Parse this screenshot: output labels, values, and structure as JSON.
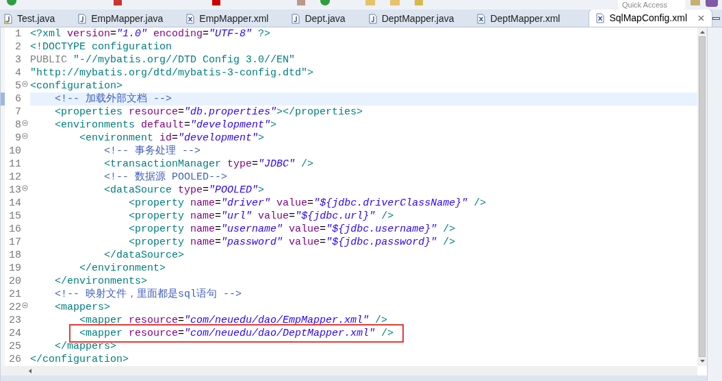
{
  "toolbar": {
    "quick_access": {
      "placeholder": "Quick Access"
    }
  },
  "tabs": [
    {
      "label": "Test.java",
      "kind": "java",
      "warning": true,
      "selected": false
    },
    {
      "label": "EmpMapper.java",
      "kind": "java",
      "warning": false,
      "selected": false
    },
    {
      "label": "EmpMapper.xml",
      "kind": "xml",
      "warning": false,
      "selected": false
    },
    {
      "label": "Dept.java",
      "kind": "java",
      "warning": false,
      "selected": false
    },
    {
      "label": "DeptMapper.java",
      "kind": "java",
      "warning": false,
      "selected": false
    },
    {
      "label": "DeptMapper.xml",
      "kind": "xml",
      "warning": false,
      "selected": false
    },
    {
      "label": "SqlMapConfig.xml",
      "kind": "xml",
      "warning": false,
      "selected": true
    }
  ],
  "editor": {
    "lines": [
      {
        "number": "1",
        "fold": false,
        "current": false,
        "boxed": false,
        "tokens": [
          {
            "kind": "tag",
            "text": "<?xml "
          },
          {
            "kind": "attr",
            "text": "version"
          },
          {
            "kind": "plain",
            "text": "="
          },
          {
            "kind": "value",
            "text": "\"1.0\""
          },
          {
            "kind": "attr",
            "text": " encoding"
          },
          {
            "kind": "plain",
            "text": "="
          },
          {
            "kind": "value",
            "text": "\"UTF-8\""
          },
          {
            "kind": "tag",
            "text": " ?>"
          }
        ]
      },
      {
        "number": "2",
        "fold": false,
        "current": false,
        "boxed": false,
        "tokens": [
          {
            "kind": "tag",
            "text": "<!DOCTYPE configuration"
          }
        ]
      },
      {
        "number": "3",
        "fold": false,
        "current": false,
        "boxed": false,
        "tokens": [
          {
            "kind": "keyword",
            "text": "PUBLIC "
          },
          {
            "kind": "tag",
            "text": "\"-//mybatis.org//DTD Config 3.0//EN\""
          }
        ]
      },
      {
        "number": "4",
        "fold": false,
        "current": false,
        "boxed": false,
        "tokens": [
          {
            "kind": "tag",
            "text": "\"http://mybatis.org/dtd/mybatis-3-config.dtd\">"
          }
        ]
      },
      {
        "number": "5",
        "fold": true,
        "current": false,
        "boxed": false,
        "tokens": [
          {
            "kind": "tag",
            "text": "<configuration>"
          }
        ]
      },
      {
        "number": "6",
        "fold": false,
        "current": true,
        "boxed": false,
        "tokens": [
          {
            "kind": "comment",
            "text": "    <!-- 加载外部文档 -->"
          }
        ]
      },
      {
        "number": "7",
        "fold": false,
        "current": false,
        "boxed": false,
        "tokens": [
          {
            "kind": "tag",
            "text": "    <properties "
          },
          {
            "kind": "attr",
            "text": "resource"
          },
          {
            "kind": "plain",
            "text": "="
          },
          {
            "kind": "value",
            "text": "\"db.properties\""
          },
          {
            "kind": "tag",
            "text": "></properties>"
          }
        ]
      },
      {
        "number": "8",
        "fold": true,
        "current": false,
        "boxed": false,
        "tokens": [
          {
            "kind": "tag",
            "text": "    <environments "
          },
          {
            "kind": "attr",
            "text": "default"
          },
          {
            "kind": "plain",
            "text": "="
          },
          {
            "kind": "value",
            "text": "\"development\""
          },
          {
            "kind": "tag",
            "text": ">"
          }
        ]
      },
      {
        "number": "9",
        "fold": true,
        "current": false,
        "boxed": false,
        "tokens": [
          {
            "kind": "tag",
            "text": "        <environment "
          },
          {
            "kind": "attr",
            "text": "id"
          },
          {
            "kind": "plain",
            "text": "="
          },
          {
            "kind": "value",
            "text": "\"development\""
          },
          {
            "kind": "tag",
            "text": ">"
          }
        ]
      },
      {
        "number": "10",
        "fold": false,
        "current": false,
        "boxed": false,
        "tokens": [
          {
            "kind": "comment",
            "text": "            <!-- 事务处理 -->"
          }
        ]
      },
      {
        "number": "11",
        "fold": false,
        "current": false,
        "boxed": false,
        "tokens": [
          {
            "kind": "tag",
            "text": "            <transactionManager "
          },
          {
            "kind": "attr",
            "text": "type"
          },
          {
            "kind": "plain",
            "text": "="
          },
          {
            "kind": "value",
            "text": "\"JDBC\""
          },
          {
            "kind": "tag",
            "text": " />"
          }
        ]
      },
      {
        "number": "12",
        "fold": false,
        "current": false,
        "boxed": false,
        "tokens": [
          {
            "kind": "comment",
            "text": "            <!-- 数据源 POOLED-->"
          }
        ]
      },
      {
        "number": "13",
        "fold": true,
        "current": false,
        "boxed": false,
        "tokens": [
          {
            "kind": "tag",
            "text": "            <dataSource "
          },
          {
            "kind": "attr",
            "text": "type"
          },
          {
            "kind": "plain",
            "text": "="
          },
          {
            "kind": "value",
            "text": "\"POOLED\""
          },
          {
            "kind": "tag",
            "text": ">"
          }
        ]
      },
      {
        "number": "14",
        "fold": false,
        "current": false,
        "boxed": false,
        "tokens": [
          {
            "kind": "tag",
            "text": "                <property "
          },
          {
            "kind": "attr",
            "text": "name"
          },
          {
            "kind": "plain",
            "text": "="
          },
          {
            "kind": "value",
            "text": "\"driver\""
          },
          {
            "kind": "attr",
            "text": " value"
          },
          {
            "kind": "plain",
            "text": "="
          },
          {
            "kind": "value",
            "text": "\"${jdbc.driverClassName}\""
          },
          {
            "kind": "tag",
            "text": " />"
          }
        ]
      },
      {
        "number": "15",
        "fold": false,
        "current": false,
        "boxed": false,
        "tokens": [
          {
            "kind": "tag",
            "text": "                <property "
          },
          {
            "kind": "attr",
            "text": "name"
          },
          {
            "kind": "plain",
            "text": "="
          },
          {
            "kind": "value",
            "text": "\"url\""
          },
          {
            "kind": "attr",
            "text": " value"
          },
          {
            "kind": "plain",
            "text": "="
          },
          {
            "kind": "value",
            "text": "\"${jdbc.url}\""
          },
          {
            "kind": "tag",
            "text": " />"
          }
        ]
      },
      {
        "number": "16",
        "fold": false,
        "current": false,
        "boxed": false,
        "tokens": [
          {
            "kind": "tag",
            "text": "                <property "
          },
          {
            "kind": "attr",
            "text": "name"
          },
          {
            "kind": "plain",
            "text": "="
          },
          {
            "kind": "value",
            "text": "\"username\""
          },
          {
            "kind": "attr",
            "text": " value"
          },
          {
            "kind": "plain",
            "text": "="
          },
          {
            "kind": "value",
            "text": "\"${jdbc.username}\""
          },
          {
            "kind": "tag",
            "text": " />"
          }
        ]
      },
      {
        "number": "17",
        "fold": false,
        "current": false,
        "boxed": false,
        "tokens": [
          {
            "kind": "tag",
            "text": "                <property "
          },
          {
            "kind": "attr",
            "text": "name"
          },
          {
            "kind": "plain",
            "text": "="
          },
          {
            "kind": "value",
            "text": "\"password\""
          },
          {
            "kind": "attr",
            "text": " value"
          },
          {
            "kind": "plain",
            "text": "="
          },
          {
            "kind": "value",
            "text": "\"${jdbc.password}\""
          },
          {
            "kind": "tag",
            "text": " />"
          }
        ]
      },
      {
        "number": "18",
        "fold": false,
        "current": false,
        "boxed": false,
        "tokens": [
          {
            "kind": "tag",
            "text": "            </dataSource>"
          }
        ]
      },
      {
        "number": "19",
        "fold": false,
        "current": false,
        "boxed": false,
        "tokens": [
          {
            "kind": "tag",
            "text": "        </environment>"
          }
        ]
      },
      {
        "number": "20",
        "fold": false,
        "current": false,
        "boxed": false,
        "tokens": [
          {
            "kind": "tag",
            "text": "    </environments>"
          }
        ]
      },
      {
        "number": "21",
        "fold": false,
        "current": false,
        "boxed": false,
        "tokens": [
          {
            "kind": "comment",
            "text": "    <!-- 映射文件，里面都是sql语句 -->"
          }
        ]
      },
      {
        "number": "22",
        "fold": true,
        "current": false,
        "boxed": false,
        "tokens": [
          {
            "kind": "tag",
            "text": "    <mappers>"
          }
        ]
      },
      {
        "number": "23",
        "fold": false,
        "current": false,
        "boxed": false,
        "tokens": [
          {
            "kind": "tag",
            "text": "        <mapper "
          },
          {
            "kind": "attr",
            "text": "resource"
          },
          {
            "kind": "plain",
            "text": "="
          },
          {
            "kind": "value",
            "text": "\"com/neuedu/dao/EmpMapper.xml\""
          },
          {
            "kind": "tag",
            "text": " />"
          }
        ]
      },
      {
        "number": "24",
        "fold": false,
        "current": false,
        "boxed": true,
        "tokens": [
          {
            "kind": "tag",
            "text": "        <mapper "
          },
          {
            "kind": "attr",
            "text": "resource"
          },
          {
            "kind": "plain",
            "text": "="
          },
          {
            "kind": "value",
            "text": "\"com/neuedu/dao/DeptMapper.xml\""
          },
          {
            "kind": "tag",
            "text": " />"
          }
        ]
      },
      {
        "number": "25",
        "fold": false,
        "current": false,
        "boxed": false,
        "tokens": [
          {
            "kind": "tag",
            "text": "    </mappers>"
          }
        ]
      },
      {
        "number": "26",
        "fold": false,
        "current": false,
        "boxed": false,
        "tokens": [
          {
            "kind": "tag",
            "text": "</configuration>"
          }
        ]
      }
    ]
  }
}
